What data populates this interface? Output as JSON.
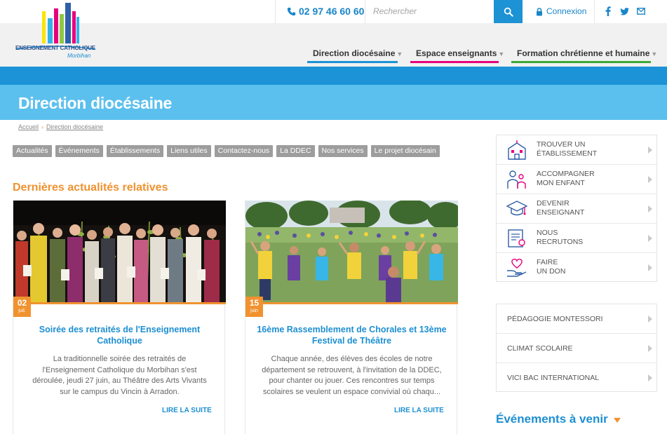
{
  "brand": {
    "logo_text": "ENSEIGNEMENT CATHOLIQUE",
    "logo_sub": "Morbihan"
  },
  "topbar": {
    "phone": "02 97 46 60 60",
    "search_placeholder": "Rechercher",
    "connexion_label": "Connexion",
    "social": [
      "facebook-icon",
      "twitter-icon",
      "email-icon"
    ]
  },
  "nav": {
    "items": [
      {
        "label": "Direction diocésaine",
        "color": "#1d92d4"
      },
      {
        "label": "Espace enseignants",
        "color": "#e6007e"
      },
      {
        "label": "Formation chrétienne et humaine",
        "color": "#3aaa35"
      }
    ]
  },
  "page": {
    "title": "Direction diocésaine"
  },
  "breadcrumb": {
    "home": "Accueil",
    "current": "Direction diocésaine"
  },
  "tags": [
    "Actualités",
    "Événements",
    "Établissements",
    "Liens utiles",
    "Contactez-nous",
    "La DDEC",
    "Nos services",
    "Le projet diocésain"
  ],
  "news": {
    "section_title": "Dernières actualités relatives",
    "items": [
      {
        "day": "02",
        "month": "juil.",
        "title": "Soirée des retraités de l'Enseignement Catholique",
        "text": "La traditionnelle soirée des retraités de l'Enseignement Catholique du Morbihan s'est déroulée, jeudi 27 juin, au Théâtre des Arts Vivants sur le campus du Vincin à Arradon.",
        "read_more": "LIRE LA SUITE"
      },
      {
        "day": "15",
        "month": "juin",
        "title": "16ème Rassemblement de Chorales et 13ème Festival de Théâtre",
        "text": "Chaque année, des élèves des écoles de notre département se retrouvent, à l'invitation de la DDEC, pour chanter ou jouer. Ces rencontres sur temps scolaires se veulent un espace convivial où chaqu...",
        "read_more": "LIRE LA SUITE"
      }
    ]
  },
  "sidebar": {
    "quick_links": [
      {
        "line1": "TROUVER UN",
        "line2": "ÉTABLISSEMENT",
        "icon": "school-icon"
      },
      {
        "line1": "ACCOMPAGNER",
        "line2": "MON ENFANT",
        "icon": "family-icon"
      },
      {
        "line1": "DEVENIR",
        "line2": "ENSEIGNANT",
        "icon": "graduation-cap-icon"
      },
      {
        "line1": "NOUS",
        "line2": "RECRUTONS",
        "icon": "certificate-icon"
      },
      {
        "line1": "FAIRE",
        "line2": "UN DON",
        "icon": "heart-hand-icon"
      }
    ],
    "themes": [
      "PÉDAGOGIE MONTESSORI",
      "CLIMAT SCOLAIRE",
      "VICI BAC INTERNATIONAL"
    ],
    "events_title": "Événements à venir"
  },
  "colors": {
    "primary": "#1d92d4",
    "light_blue": "#5cc0ee",
    "accent": "#f0922f"
  }
}
